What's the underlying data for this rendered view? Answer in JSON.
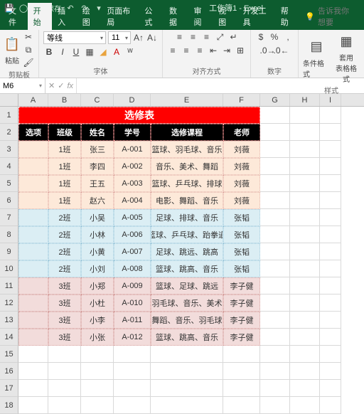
{
  "app": {
    "doc_title": "工作簿1 - Excel",
    "autosave": "自动保存"
  },
  "tabs": {
    "file": "文件",
    "home": "开始",
    "insert": "插入",
    "draw": "绘图",
    "layout": "页面布局",
    "formulas": "公式",
    "data": "数据",
    "review": "审阅",
    "view": "视图",
    "developer": "开发工具",
    "help": "帮助",
    "tell_me": "告诉我你想要"
  },
  "ribbon": {
    "clipboard": {
      "paste": "粘贴",
      "label": "剪贴板"
    },
    "font": {
      "name": "等线",
      "size": "11",
      "label": "字体"
    },
    "alignment": {
      "label": "对齐方式"
    },
    "number": {
      "label": "数字"
    },
    "styles": {
      "cond": "条件格式",
      "table": "套用\n表格格式",
      "label": "样式"
    }
  },
  "formula_bar": {
    "cell_ref": "M6",
    "value": ""
  },
  "columns": [
    "A",
    "B",
    "C",
    "D",
    "E",
    "F",
    "G",
    "H",
    "I"
  ],
  "sheet_title": "选修表",
  "headers": [
    "选项",
    "班级",
    "姓名",
    "学号",
    "选修课程",
    "老师"
  ],
  "rows": [
    {
      "g": 1,
      "d": [
        "",
        "1班",
        "张三",
        "A-001",
        "篮球、羽毛球、音乐",
        "刘薇"
      ]
    },
    {
      "g": 1,
      "d": [
        "",
        "1班",
        "李四",
        "A-002",
        "音乐、美术、舞蹈",
        "刘薇"
      ]
    },
    {
      "g": 1,
      "d": [
        "",
        "1班",
        "王五",
        "A-003",
        "篮球、乒乓球、排球",
        "刘薇"
      ]
    },
    {
      "g": 1,
      "d": [
        "",
        "1班",
        "赵六",
        "A-004",
        "电影、舞蹈、音乐",
        "刘薇"
      ]
    },
    {
      "g": 2,
      "d": [
        "",
        "2班",
        "小吴",
        "A-005",
        "足球、排球、音乐",
        "张韬"
      ]
    },
    {
      "g": 2,
      "d": [
        "",
        "2班",
        "小林",
        "A-006",
        "篮球、乒乓球、跆拳道",
        "张韬"
      ]
    },
    {
      "g": 2,
      "d": [
        "",
        "2班",
        "小黄",
        "A-007",
        "足球、跳远、跳高",
        "张韬"
      ]
    },
    {
      "g": 2,
      "d": [
        "",
        "2班",
        "小刘",
        "A-008",
        "篮球、跳高、音乐",
        "张韬"
      ]
    },
    {
      "g": 3,
      "d": [
        "",
        "3班",
        "小郑",
        "A-009",
        "篮球、足球、跳远",
        "李子健"
      ]
    },
    {
      "g": 3,
      "d": [
        "",
        "3班",
        "小杜",
        "A-010",
        "羽毛球、音乐、美术",
        "李子健"
      ]
    },
    {
      "g": 3,
      "d": [
        "",
        "3班",
        "小李",
        "A-011",
        "舞蹈、音乐、羽毛球",
        "李子健"
      ]
    },
    {
      "g": 3,
      "d": [
        "",
        "3班",
        "小张",
        "A-012",
        "篮球、跳高、音乐",
        "李子健"
      ]
    }
  ],
  "empty_rows": [
    15,
    16,
    17,
    18
  ]
}
